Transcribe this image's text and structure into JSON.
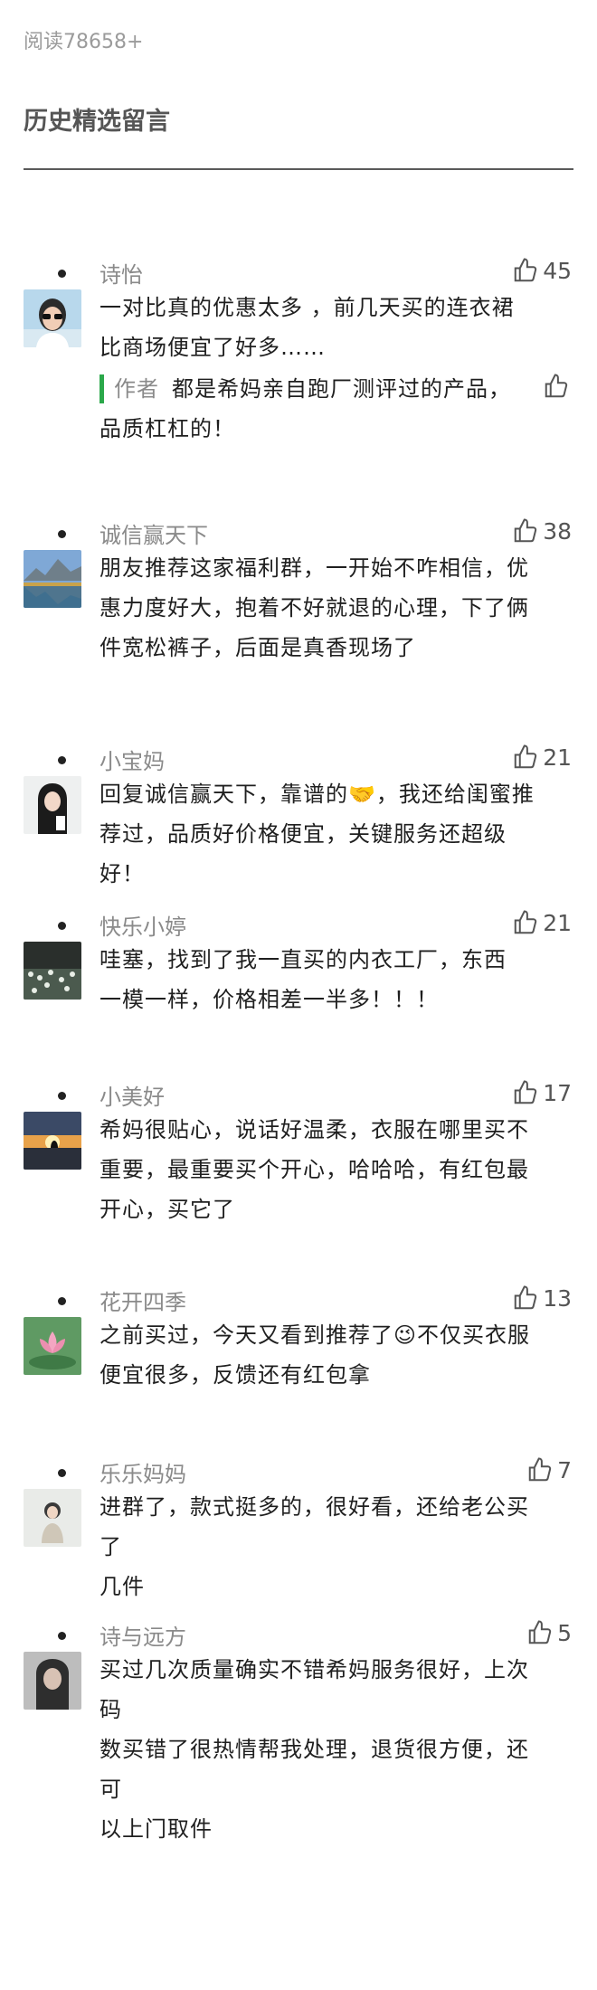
{
  "read_count": "阅读78658+",
  "section_title": "历史精选留言",
  "author_tag": "作者",
  "comments": [
    {
      "nick": "诗怡",
      "likes": "45",
      "avatar": "woman-sunglasses",
      "lines": [
        "一对比真的优惠太多 ，前几天买的连衣裙",
        "比商场便宜了好多……"
      ],
      "reply_lines": [
        "都是希妈亲自跑厂测评过的产品，",
        "品质杠杠的！"
      ]
    },
    {
      "nick": "诚信赢天下",
      "likes": "38",
      "avatar": "mountain-lake",
      "lines": [
        "朋友推荐这家福利群，一开始不咋相信，优",
        "惠力度好大，抱着不好就退的心理，下了俩",
        "件宽松裤子，后面是真香现场了"
      ]
    },
    {
      "nick": "小宝妈",
      "likes": "21",
      "avatar": "girl-long-hair",
      "lines": [
        "回复诚信赢天下，靠谱的🤝，我还给闺蜜推",
        "荐过，品质好价格便宜，关键服务还超级好！"
      ]
    },
    {
      "nick": "快乐小婷",
      "likes": "21",
      "avatar": "night-flowers",
      "lines": [
        "哇塞，找到了我一直买的内衣工厂，东西",
        "一模一样，价格相差一半多！！！"
      ]
    },
    {
      "nick": "小美好",
      "likes": "17",
      "avatar": "sunset-silhouette",
      "lines": [
        "希妈很贴心，说话好温柔，衣服在哪里买不",
        "重要，最重要买个开心，哈哈哈，有红包最",
        "开心，买它了"
      ]
    },
    {
      "nick": "花开四季",
      "likes": "13",
      "avatar": "lotus-flower",
      "lines": [
        "之前买过，今天又看到推荐了😉不仅买衣服",
        "便宜很多，反馈还有红包拿"
      ]
    },
    {
      "nick": "乐乐妈妈",
      "likes": "7",
      "avatar": "kid-photo",
      "lines": [
        "进群了，款式挺多的，很好看，还给老公买了",
        "几件"
      ]
    },
    {
      "nick": "诗与远方",
      "likes": "5",
      "avatar": "woman-dark",
      "lines": [
        "买过几次质量确实不错希妈服务很好，上次码",
        "数买错了很热情帮我处理，退货很方便，还可",
        "以上门取件"
      ]
    }
  ],
  "colors": {
    "accent": "#2ba84a",
    "nick": "#8a8a8a",
    "text": "#1f1f1f"
  }
}
